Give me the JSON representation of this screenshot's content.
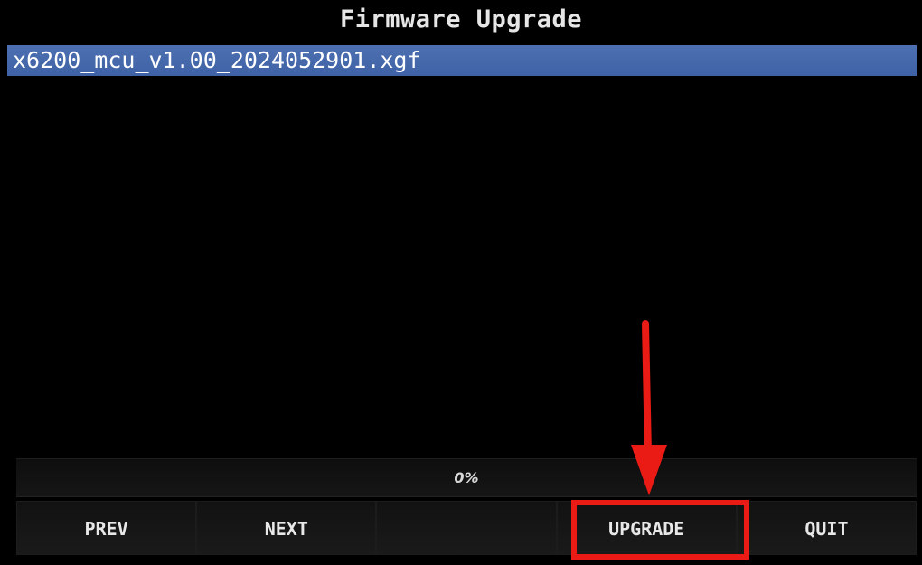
{
  "title": "Firmware Upgrade",
  "file_list": {
    "items": [
      {
        "name": "x6200_mcu_v1.00_2024052901.xgf",
        "selected": true
      }
    ]
  },
  "progress": {
    "value": 0,
    "label": "0%"
  },
  "buttons": {
    "prev": "PREV",
    "next": "NEXT",
    "empty": "",
    "upgrade": "UPGRADE",
    "quit": "QUIT"
  },
  "colors": {
    "background": "#000000",
    "selection": "#3f62a6",
    "annotation": "#ea1a14"
  },
  "annotation": {
    "target": "upgrade-button",
    "arrow_icon": "red-arrow-down-icon"
  }
}
